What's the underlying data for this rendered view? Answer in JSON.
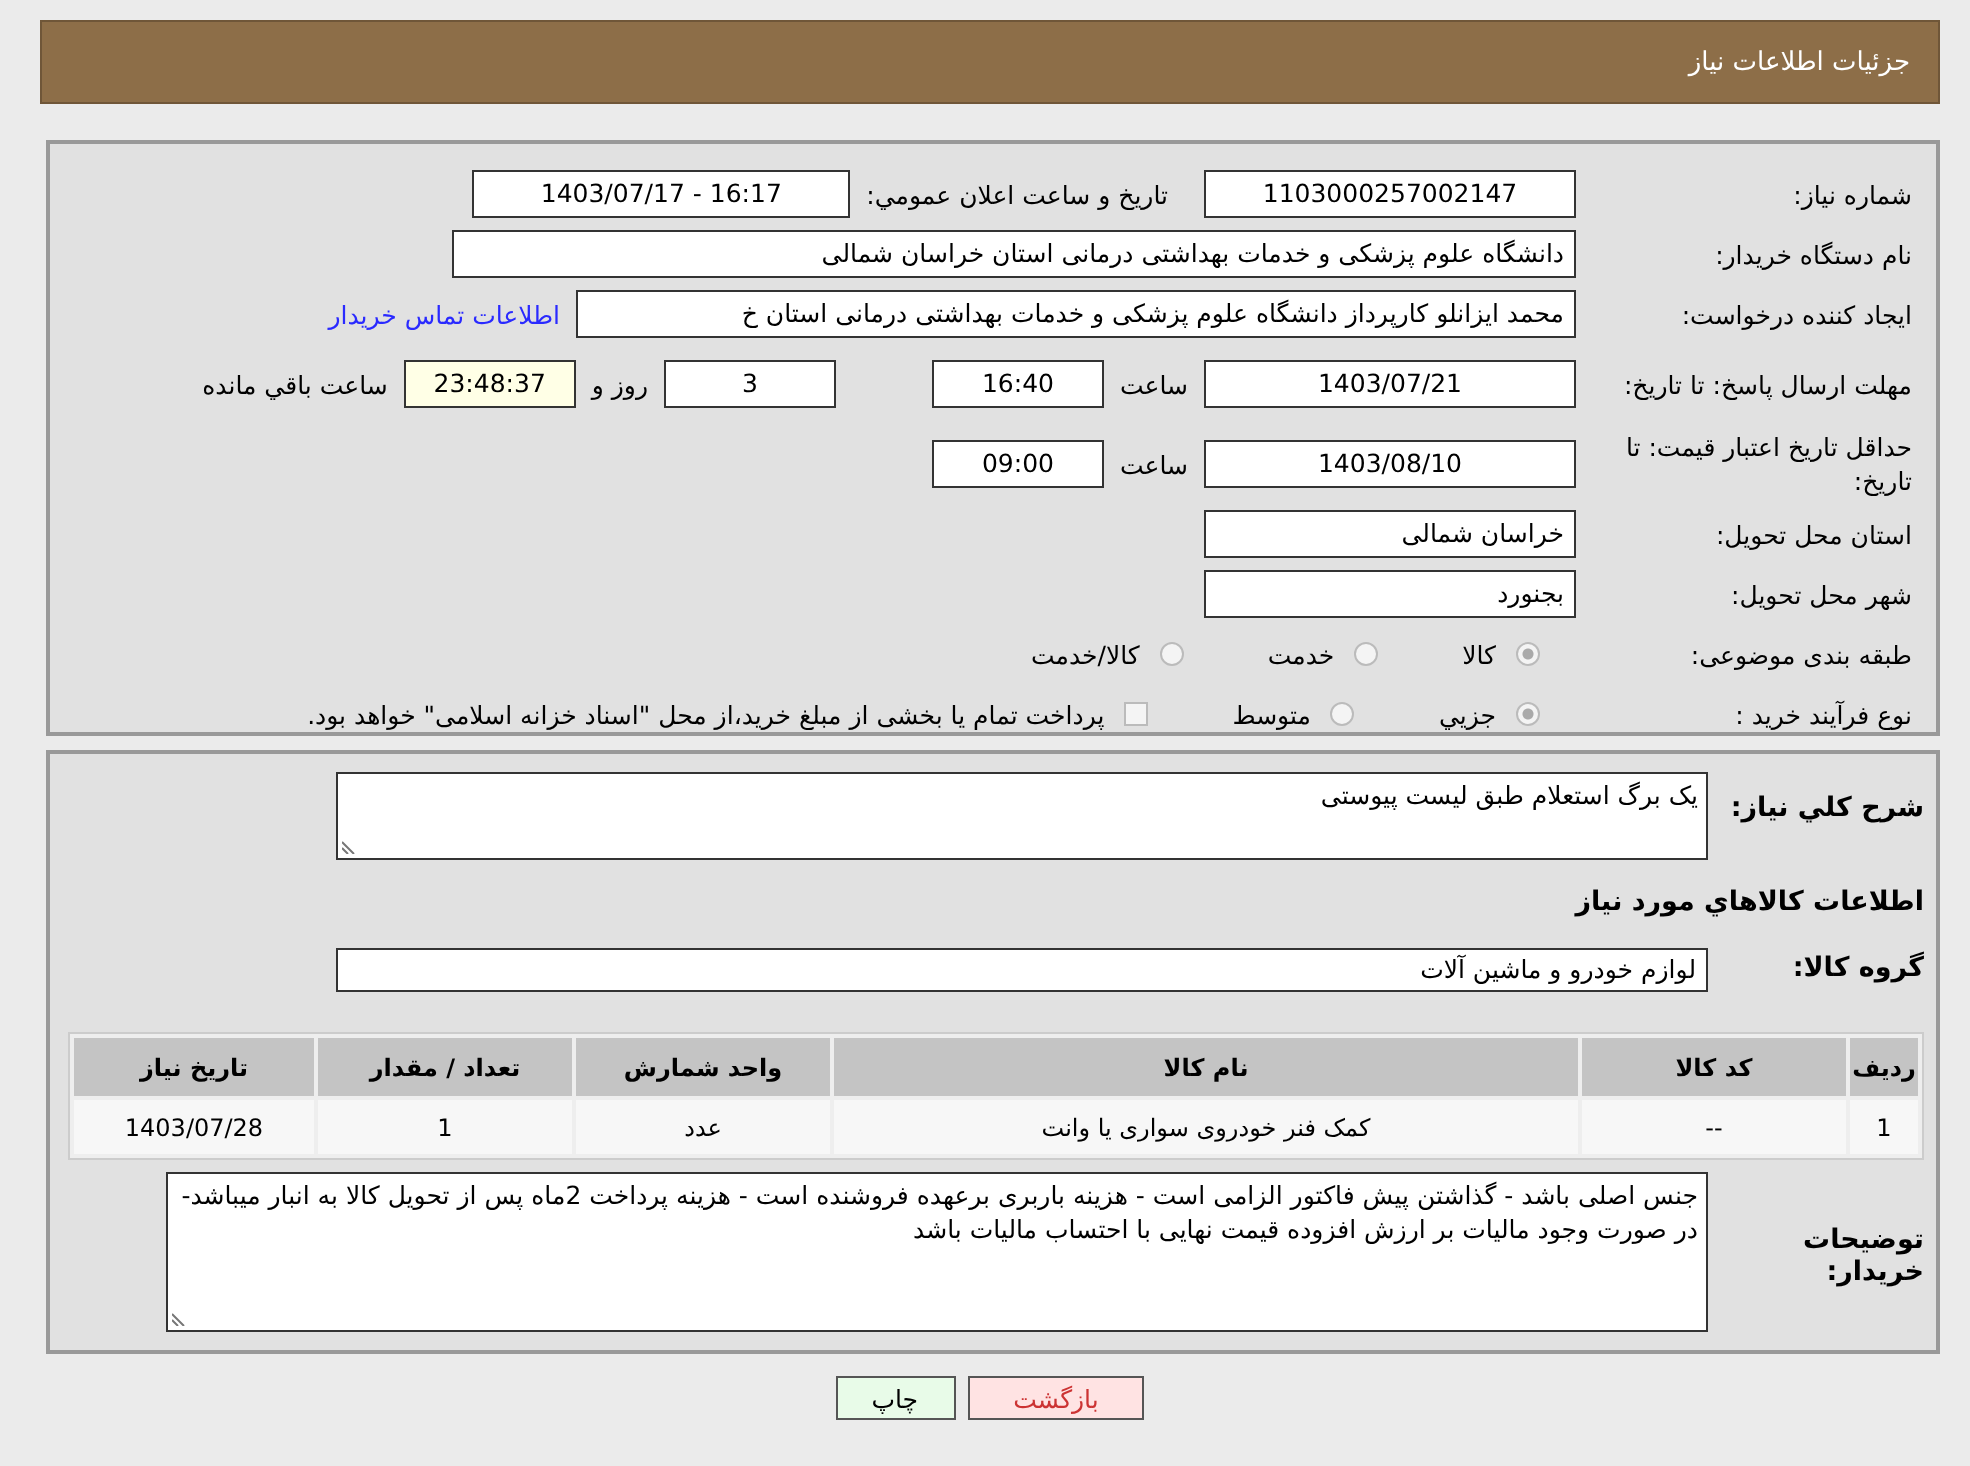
{
  "header": {
    "title": "جزئیات اطلاعات نیاز"
  },
  "need_number": {
    "label": "شماره نیاز:",
    "value": "1103000257002147"
  },
  "announce": {
    "label": "تاریخ و ساعت اعلان عمومي:",
    "value": "1403/07/17 - 16:17"
  },
  "buyer_org": {
    "label": "نام دستگاه خریدار:",
    "value": "دانشگاه علوم پزشکی و خدمات بهداشتی درمانی استان خراسان شمالی"
  },
  "requester": {
    "label": "ایجاد کننده درخواست:",
    "value": "محمد ایزانلو کارپرداز دانشگاه علوم پزشکی و خدمات بهداشتی درمانی استان خ",
    "link": "اطلاعات تماس خریدار"
  },
  "deadline": {
    "label": "مهلت ارسال پاسخ: تا تاریخ:",
    "date": "1403/07/21",
    "time_label": "ساعت",
    "time": "16:40",
    "days": "3",
    "days_label": "روز و",
    "remaining": "23:48:37",
    "remaining_label": "ساعت باقي مانده"
  },
  "validity": {
    "label": "حداقل تاریخ اعتبار قیمت: تا تاریخ:",
    "date": "1403/08/10",
    "time_label": "ساعت",
    "time": "09:00"
  },
  "province": {
    "label": "استان محل تحویل:",
    "value": "خراسان شمالی"
  },
  "city": {
    "label": "شهر محل تحویل:",
    "value": "بجنورد"
  },
  "category": {
    "label": "طبقه بندی موضوعی:",
    "options": [
      {
        "label": "کالا",
        "selected": true
      },
      {
        "label": "خدمت",
        "selected": false
      },
      {
        "label": "کالا/خدمت",
        "selected": false
      }
    ]
  },
  "process": {
    "label": "نوع فرآیند خرید :",
    "options": [
      {
        "label": "جزيي",
        "selected": true
      },
      {
        "label": "متوسط",
        "selected": false
      }
    ],
    "note": {
      "label": "پرداخت تمام یا بخشی از مبلغ خرید،از محل \"اسناد خزانه اسلامی\" خواهد بود.",
      "checked": false
    }
  },
  "description": {
    "label": "شرح کلي نیاز:",
    "value": "یک برگ استعلام طبق لیست پیوستی"
  },
  "goods_title": "اطلاعات کالاهاي مورد نیاز",
  "goods_group": {
    "label": "گروه کالا:",
    "value": "لوازم خودرو و ماشین آلات"
  },
  "table": {
    "columns": [
      "ردیف",
      "کد کالا",
      "نام کالا",
      "واحد شمارش",
      "تعداد / مقدار",
      "تاریخ نیاز"
    ],
    "rows": [
      [
        "1",
        "--",
        "کمک فنر خودروی سواری یا وانت",
        "عدد",
        "1",
        "1403/07/28"
      ]
    ]
  },
  "buyer_notes": {
    "label": "توضیحات خریدار:",
    "value": "جنس اصلی باشد - گذاشتن پیش فاکتور الزامی است - هزینه باربری برعهده فروشنده است - هزینه پرداخت 2ماه پس از تحویل کالا به انبار میباشد- در صورت وجود مالیات بر ارزش افزوده قیمت نهایی با احتساب مالیات باشد"
  },
  "buttons": [
    {
      "label": "بازگشت",
      "kind": "back"
    },
    {
      "label": "چاپ",
      "kind": "print"
    }
  ]
}
